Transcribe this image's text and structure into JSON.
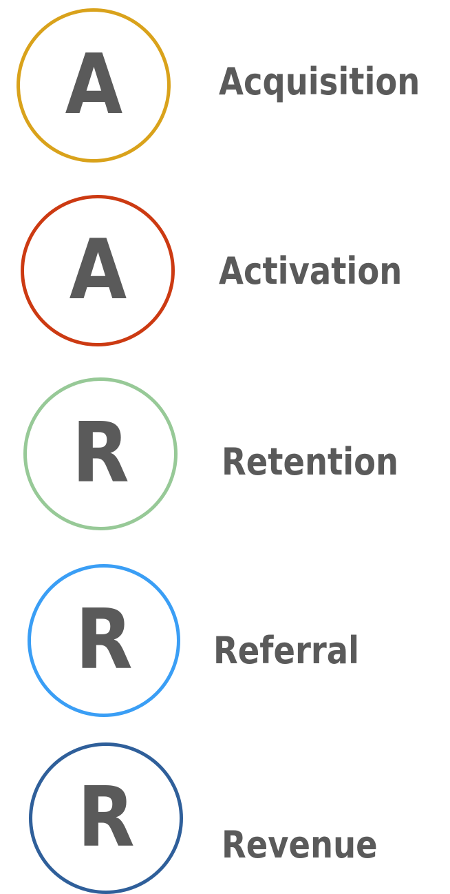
{
  "items": [
    {
      "letter": "A",
      "label": "Acquisition",
      "color": "#d9a21b"
    },
    {
      "letter": "A",
      "label": "Activation",
      "color": "#cc3a12"
    },
    {
      "letter": "R",
      "label": "Retention",
      "color": "#97c997"
    },
    {
      "letter": "R",
      "label": "Referral",
      "color": "#3a9ef5"
    },
    {
      "letter": "R",
      "label": "Revenue",
      "color": "#2f5f9a"
    }
  ]
}
